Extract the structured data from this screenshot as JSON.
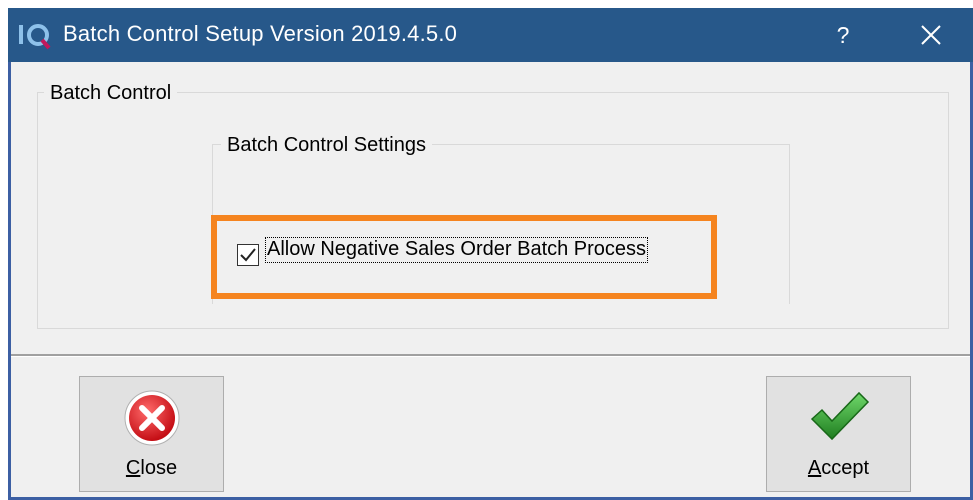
{
  "window": {
    "title": "Batch Control Setup Version 2019.4.5.0",
    "help_label": "?",
    "close_label": "Close window"
  },
  "groups": {
    "outer_title": "Batch Control",
    "inner_title": "Batch Control Settings"
  },
  "settings": {
    "allow_negative_label": "Allow Negative Sales Order Batch Process",
    "allow_negative_checked": true
  },
  "buttons": {
    "close": {
      "accel": "C",
      "rest": "lose"
    },
    "accept": {
      "accel": "A",
      "rest": "ccept"
    }
  },
  "colors": {
    "titlebar": "#27588a",
    "highlight": "#f5841f",
    "close_icon": "#e0242b",
    "accept_icon": "#2e9a2c"
  }
}
